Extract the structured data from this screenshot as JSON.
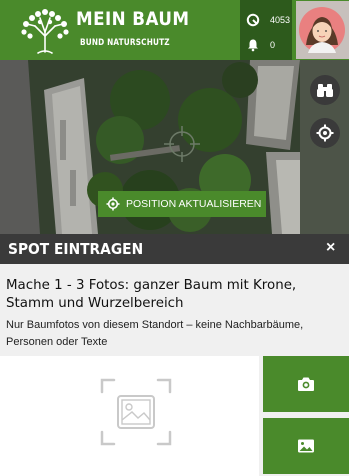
{
  "header": {
    "brand_title": "MEIN BAUM",
    "brand_subtitle": "BUND NATURSCHUTZ",
    "points_count": "4053",
    "notifications_count": "0",
    "colors": {
      "brand_green": "#4a8a2b",
      "dark_green": "#2d5a1c"
    }
  },
  "map": {
    "update_position_label": "POSITION AKTUALISIEREN",
    "icons": [
      "binoculars-icon",
      "crosshair-locate-icon",
      "map-center-crosshair-icon"
    ]
  },
  "spot": {
    "title": "SPOT EINTRAGEN",
    "close_label": "×"
  },
  "instructions": {
    "title": "Mache 1 - 3 Fotos: ganzer Baum mit Krone, Stamm und Wurzelbereich",
    "subtitle": "Nur Baumfotos von diesem Standort – keine Nachbarbäume, Personen oder Texte"
  },
  "actions": {
    "camera_icon": "camera-icon",
    "gallery_icon": "image-gallery-icon"
  }
}
